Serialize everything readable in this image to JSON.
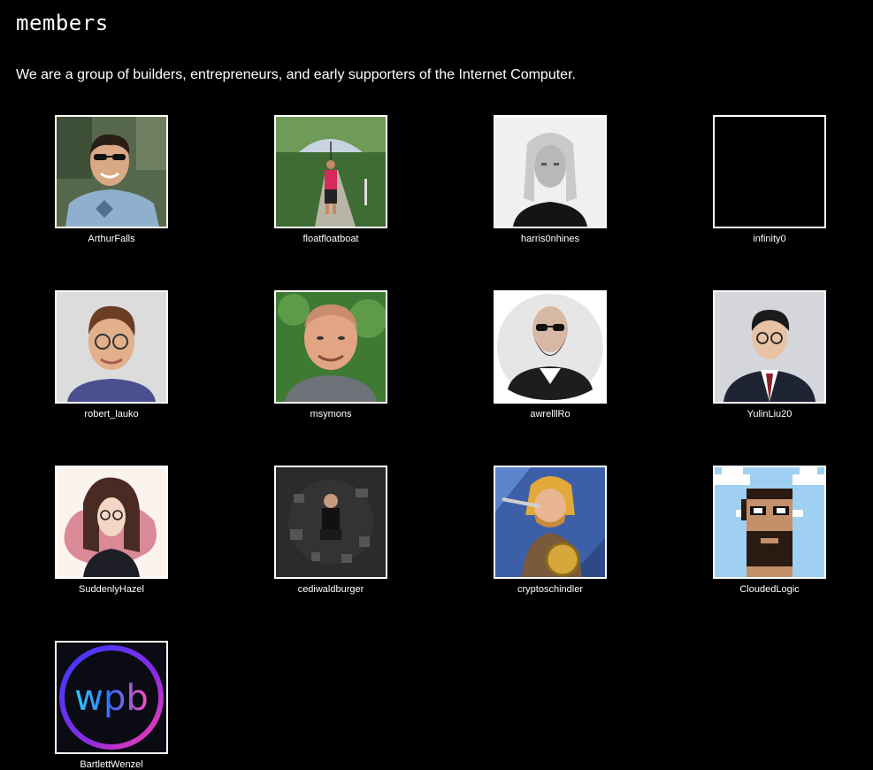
{
  "page": {
    "title": "members",
    "intro": "We are a group of builders, entrepreneurs, and early supporters of the Internet Computer."
  },
  "members": [
    {
      "name": "ArthurFalls",
      "avatar": "arthurfalls-photo"
    },
    {
      "name": "floatfloatboat",
      "avatar": "floatfloatboat-photo"
    },
    {
      "name": "harris0nhines",
      "avatar": "harris0nhines-photo"
    },
    {
      "name": "infinity0",
      "avatar": "blank-avatar"
    },
    {
      "name": "robert_lauko",
      "avatar": "robert-lauko-photo"
    },
    {
      "name": "msymons",
      "avatar": "msymons-photo"
    },
    {
      "name": "awrelllRo",
      "avatar": "awrelllro-photo"
    },
    {
      "name": "YulinLiu20",
      "avatar": "yulinliu20-photo"
    },
    {
      "name": "SuddenlyHazel",
      "avatar": "suddenlyhazel-illustration"
    },
    {
      "name": "cediwaldburger",
      "avatar": "cediwaldburger-photo"
    },
    {
      "name": "cryptoschindler",
      "avatar": "cryptoschindler-illustration"
    },
    {
      "name": "CloudedLogic",
      "avatar": "cloudedlogic-pixel-art"
    },
    {
      "name": "BartlettWenzel",
      "avatar": "bartlettwenzel-logo"
    }
  ],
  "logo_text": "wpb"
}
